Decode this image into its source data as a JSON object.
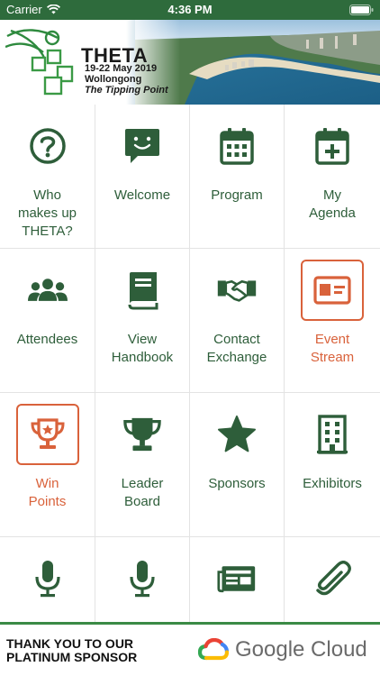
{
  "status_bar": {
    "carrier": "Carrier",
    "time": "4:36 PM"
  },
  "banner": {
    "title": "THETA",
    "dates": "19-22 May 2019",
    "location": "Wollongong",
    "tagline": "The Tipping Point"
  },
  "menu": {
    "items": [
      {
        "label": "Who\nmakes up\nTHETA?",
        "icon": "help-circle-icon"
      },
      {
        "label": "Welcome",
        "icon": "chat-smile-icon"
      },
      {
        "label": "Program",
        "icon": "calendar-grid-icon"
      },
      {
        "label": "My\nAgenda",
        "icon": "calendar-plus-icon"
      },
      {
        "label": "Attendees",
        "icon": "users-icon"
      },
      {
        "label": "View\nHandbook",
        "icon": "book-icon"
      },
      {
        "label": "Contact\nExchange",
        "icon": "handshake-icon"
      },
      {
        "label": "Event\nStream",
        "icon": "id-card-icon"
      },
      {
        "label": "Win\nPoints",
        "icon": "trophy-star-icon"
      },
      {
        "label": "Leader\nBoard",
        "icon": "trophy-icon"
      },
      {
        "label": "Sponsors",
        "icon": "star-icon"
      },
      {
        "label": "Exhibitors",
        "icon": "building-icon"
      },
      {
        "label": "",
        "icon": "microphone-icon"
      },
      {
        "label": "",
        "icon": "microphone-icon"
      },
      {
        "label": "",
        "icon": "newspaper-icon"
      },
      {
        "label": "",
        "icon": "paperclip-icon"
      }
    ]
  },
  "colors": {
    "primary": "#2e6b3c",
    "accent": "#d9623b",
    "footer_rule": "#3a8a45"
  },
  "footer": {
    "thanks": "THANK YOU TO OUR\nPLATINUM SPONSOR",
    "sponsor_name": "Google Cloud"
  }
}
